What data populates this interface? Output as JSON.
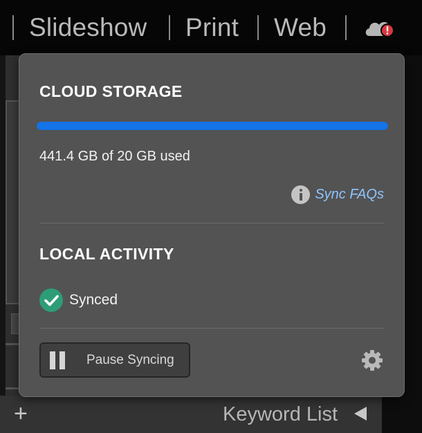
{
  "top_nav": {
    "modules": [
      "Slideshow",
      "Print",
      "Web"
    ]
  },
  "cloud_storage": {
    "title": "CLOUD STORAGE",
    "usage_text": "441.4 GB of 20 GB used",
    "progress_fraction": 1.0,
    "sync_faq_link": "Sync FAQs"
  },
  "local_activity": {
    "title": "LOCAL ACTIVITY",
    "status": "Synced"
  },
  "actions": {
    "pause_label": "Pause Syncing"
  },
  "background_panel": {
    "keyword_list_label": "Keyword List",
    "add_symbol": "+"
  },
  "icons": {
    "cloud_status": "cloud-error-icon",
    "info": "info-icon",
    "synced": "check-circle-icon",
    "pause": "pause-icon",
    "settings": "gear-icon",
    "collapse": "triangle-left-icon"
  },
  "colors": {
    "progress": "#1473e6",
    "link": "#8fc4ff",
    "synced": "#2d9d78",
    "error_badge": "#d7373f"
  }
}
